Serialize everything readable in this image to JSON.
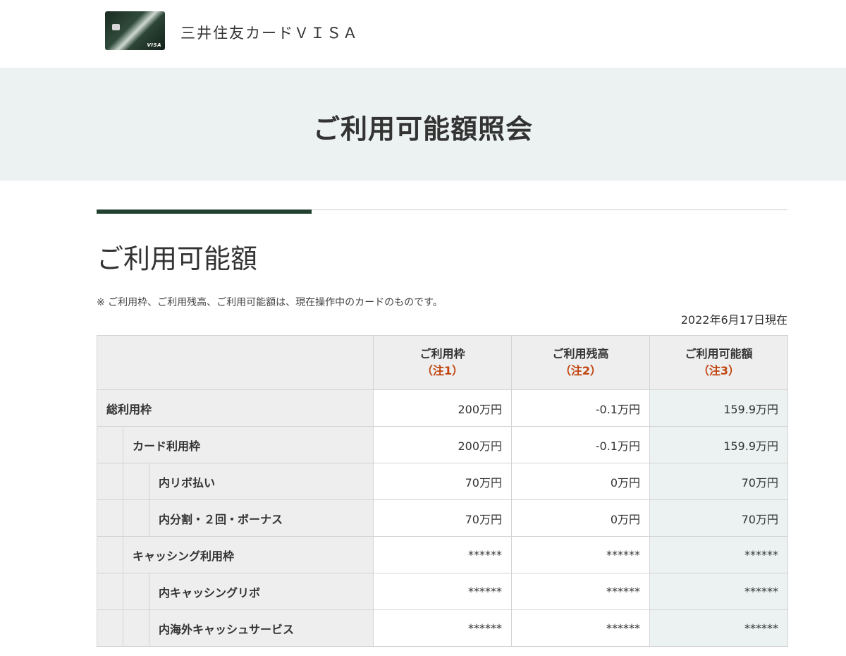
{
  "header": {
    "brand_name": "三井住友カードＶＩＳＡ",
    "card_brand": "VISA"
  },
  "banner": {
    "title": "ご利用可能額照会"
  },
  "section": {
    "title": "ご利用可能額",
    "note": "※ ご利用枠、ご利用残高、ご利用可能額は、現在操作中のカードのものです。",
    "as_of": "2022年6月17日現在"
  },
  "table": {
    "columns": [
      {
        "label": "ご利用枠",
        "note": "（注1）"
      },
      {
        "label": "ご利用残高",
        "note": "（注2）"
      },
      {
        "label": "ご利用可能額",
        "note": "（注3）"
      }
    ],
    "rows": [
      {
        "label": "総利用枠",
        "level": 0,
        "limit": "200万円",
        "balance": "-0.1万円",
        "available": "159.9万円"
      },
      {
        "label": "カード利用枠",
        "level": 1,
        "limit": "200万円",
        "balance": "-0.1万円",
        "available": "159.9万円"
      },
      {
        "label": "内リボ払い",
        "level": 2,
        "limit": "70万円",
        "balance": "0万円",
        "available": "70万円"
      },
      {
        "label": "内分割・２回・ボーナス",
        "level": 2,
        "limit": "70万円",
        "balance": "0万円",
        "available": "70万円"
      },
      {
        "label": "キャッシング利用枠",
        "level": 1,
        "limit": "******",
        "balance": "******",
        "available": "******"
      },
      {
        "label": "内キャッシングリボ",
        "level": 2,
        "limit": "******",
        "balance": "******",
        "available": "******"
      },
      {
        "label": "内海外キャッシュサービス",
        "level": 2,
        "limit": "******",
        "balance": "******",
        "available": "******"
      }
    ]
  },
  "colors": {
    "accent_green": "#234131",
    "banner_bg": "#ebf2f1",
    "note_red": "#c1440e",
    "header_cell_bg": "#eeeeee"
  }
}
